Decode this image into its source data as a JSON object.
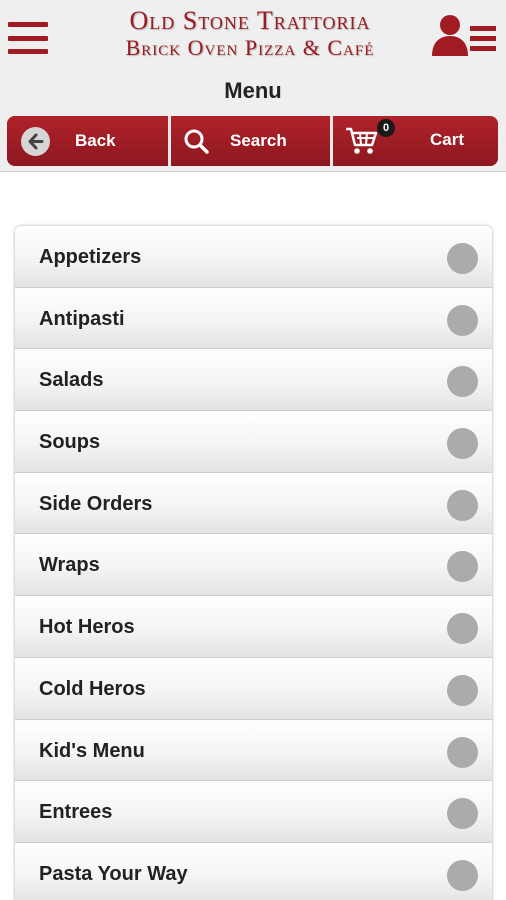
{
  "brand": {
    "line1": "Old Stone Trattoria",
    "line2": "Brick Oven Pizza & Café",
    "color": "#9b1b20"
  },
  "header": {
    "menu_icon": "hamburger-icon",
    "account_icon": "user-list-icon",
    "title": "Menu"
  },
  "toolbar": {
    "back_label": "Back",
    "back_icon": "arrow-left-circle-icon",
    "search_label": "Search",
    "search_icon": "search-icon",
    "cart_label": "Cart",
    "cart_icon": "shopping-cart-icon",
    "cart_count": "0"
  },
  "menu": {
    "items": [
      {
        "label": "Appetizers"
      },
      {
        "label": "Antipasti"
      },
      {
        "label": "Salads"
      },
      {
        "label": "Soups"
      },
      {
        "label": "Side Orders"
      },
      {
        "label": "Wraps"
      },
      {
        "label": "Hot Heros"
      },
      {
        "label": "Cold Heros"
      },
      {
        "label": "Kid's Menu"
      },
      {
        "label": "Entrees"
      },
      {
        "label": "Pasta Your Way"
      }
    ]
  }
}
